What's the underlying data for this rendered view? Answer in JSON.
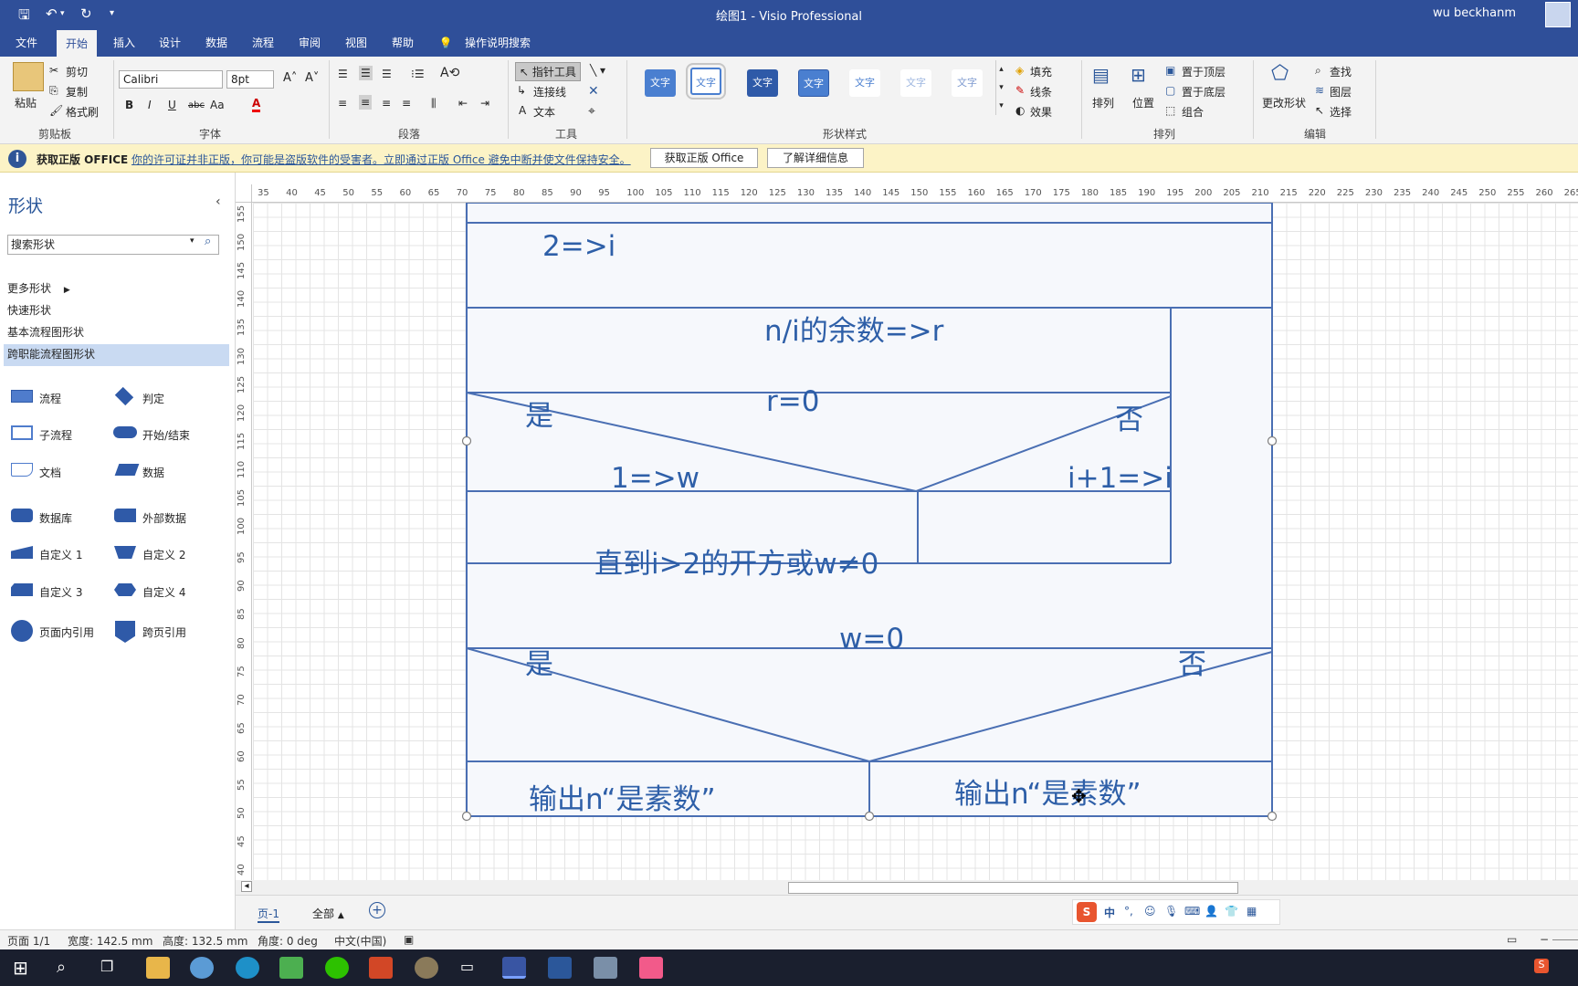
{
  "titlebar": {
    "title": "绘图1  -  Visio Professional",
    "user": "wu beckhanm"
  },
  "tabs": [
    "文件",
    "开始",
    "插入",
    "设计",
    "数据",
    "流程",
    "审阅",
    "视图",
    "帮助",
    "操作说明搜索"
  ],
  "ribbon": {
    "clipboard": {
      "paste": "粘贴",
      "cut": "剪切",
      "copy": "复制",
      "format_painter": "格式刷",
      "label": "剪贴板"
    },
    "font": {
      "family": "Calibri",
      "size": "8pt",
      "label": "字体"
    },
    "paragraph": {
      "label": "段落"
    },
    "tools": {
      "pointer": "指针工具",
      "connector": "连接线",
      "text": "文本",
      "label": "工具"
    },
    "shape_styles": {
      "sample": "文字",
      "fill": "填充",
      "line": "线条",
      "effect": "效果",
      "label": "形状样式"
    },
    "arrange": {
      "arrange": "排列",
      "position": "位置",
      "bring_front": "置于顶层",
      "send_back": "置于底层",
      "group": "组合",
      "label": "排列"
    },
    "editing": {
      "change_shape": "更改形状",
      "find": "查找",
      "layers": "图层",
      "select": "选择",
      "label": "编辑"
    }
  },
  "message_bar": {
    "title": "获取正版 OFFICE",
    "text": "你的许可证并非正版，你可能是盗版软件的受害者。立即通过正版 Office 避免中断并使文件保持安全。",
    "btn_genuine": "获取正版 Office",
    "btn_learn": "了解详细信息"
  },
  "shapes_pane": {
    "title": "形状",
    "search_placeholder": "搜索形状",
    "stencils": [
      "更多形状",
      "快速形状",
      "基本流程图形状",
      "跨职能流程图形状"
    ],
    "shapes": [
      "流程",
      "判定",
      "子流程",
      "开始/结束",
      "文档",
      "数据",
      "数据库",
      "外部数据",
      "自定义 1",
      "自定义 2",
      "自定义 3",
      "自定义 4",
      "页面内引用",
      "跨页引用"
    ]
  },
  "ruler": {
    "h_ticks": [
      "35",
      "40",
      "45",
      "50",
      "55",
      "60",
      "65",
      "70",
      "75",
      "80",
      "85",
      "90",
      "95",
      "100",
      "105",
      "110",
      "115",
      "120",
      "125",
      "130",
      "135",
      "140",
      "145",
      "150",
      "155",
      "160",
      "165",
      "170",
      "175",
      "180",
      "185",
      "190",
      "195",
      "200",
      "205",
      "210",
      "215",
      "220",
      "225",
      "230",
      "235",
      "240",
      "245",
      "250",
      "255",
      "260",
      "265"
    ],
    "v_ticks": [
      "155",
      "150",
      "145",
      "140",
      "135",
      "130",
      "125",
      "120",
      "115",
      "110",
      "105",
      "100",
      "95",
      "90",
      "85",
      "80",
      "75",
      "70",
      "65",
      "60",
      "55",
      "50",
      "45",
      "40"
    ]
  },
  "diagram": {
    "init": "2=>i",
    "remainder": "n/i的余数=>r",
    "cond1": "r=0",
    "yes1": "是",
    "no1": "否",
    "assign_w": "1=>w",
    "incr_i": "i+1=>i",
    "until": "直到i>2的开方或w≠0",
    "cond2": "w=0",
    "yes2": "是",
    "no2": "否",
    "out_left": "输出n“是素数”",
    "out_right": "输出n“是素数”",
    "line_color": "#4a6fb3",
    "text_color": "#2e5fa8"
  },
  "pages": {
    "page1": "页-1",
    "all": "全部"
  },
  "ime": {
    "lang": "中"
  },
  "status": {
    "page": "页面 1/1",
    "width": "宽度: 142.5 mm",
    "height": "高度: 132.5 mm",
    "angle": "角度: 0 deg",
    "lang": "中文(中国)"
  }
}
